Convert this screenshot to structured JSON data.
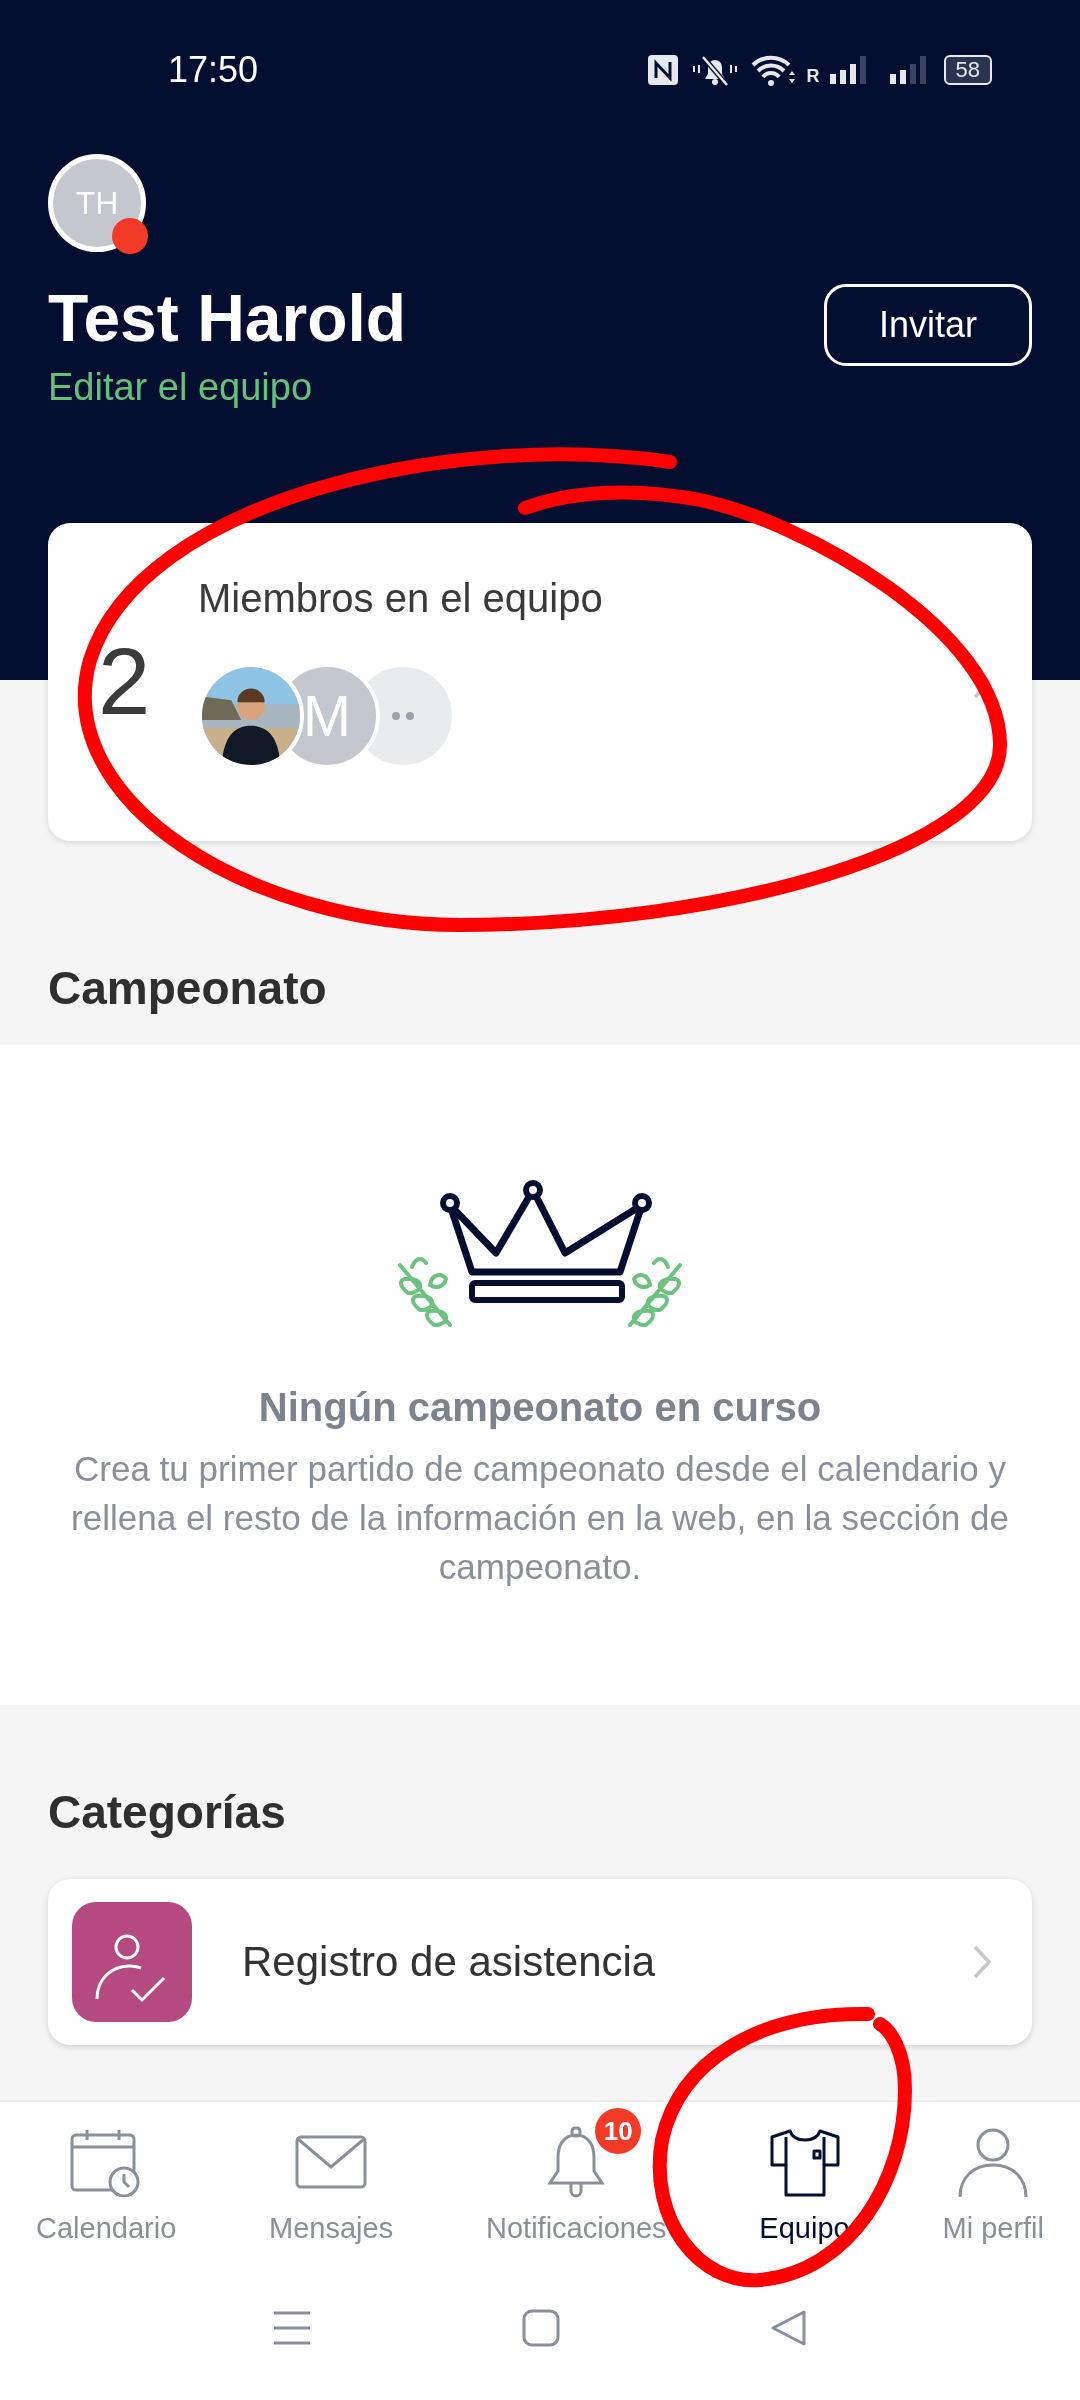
{
  "status_bar": {
    "time": "17:50",
    "roaming": "R",
    "battery": "58"
  },
  "team": {
    "avatar_initials": "TH",
    "notification_dot": true,
    "name": "Test Harold",
    "edit_link": "Editar el equipo",
    "invite_button": "Invitar"
  },
  "members_card": {
    "title": "Miembros en el equipo",
    "count": "2",
    "avatars": [
      {
        "kind": "picture"
      },
      {
        "kind": "initial",
        "text": "M"
      },
      {
        "kind": "more"
      }
    ]
  },
  "championship": {
    "heading": "Campeonato",
    "empty_title": "Ningún campeonato en curso",
    "empty_text": "Crea tu primer partido de campeonato desde el calendario y rellena el resto de la información en la web, en la sección de campeonato."
  },
  "categories": {
    "heading": "Categorías",
    "items": [
      {
        "label": "Registro de asistencia",
        "kind": "attendance"
      }
    ]
  },
  "bottom_nav": [
    {
      "label": "Calendario",
      "kind": "calendar",
      "selected": false
    },
    {
      "label": "Mensajes",
      "kind": "mail",
      "selected": false
    },
    {
      "label": "Notificaciones",
      "kind": "bell",
      "selected": false,
      "badge": "10"
    },
    {
      "label": "Equipo",
      "kind": "shirt",
      "selected": true
    },
    {
      "label": "Mi perfil",
      "kind": "person",
      "selected": false
    }
  ]
}
